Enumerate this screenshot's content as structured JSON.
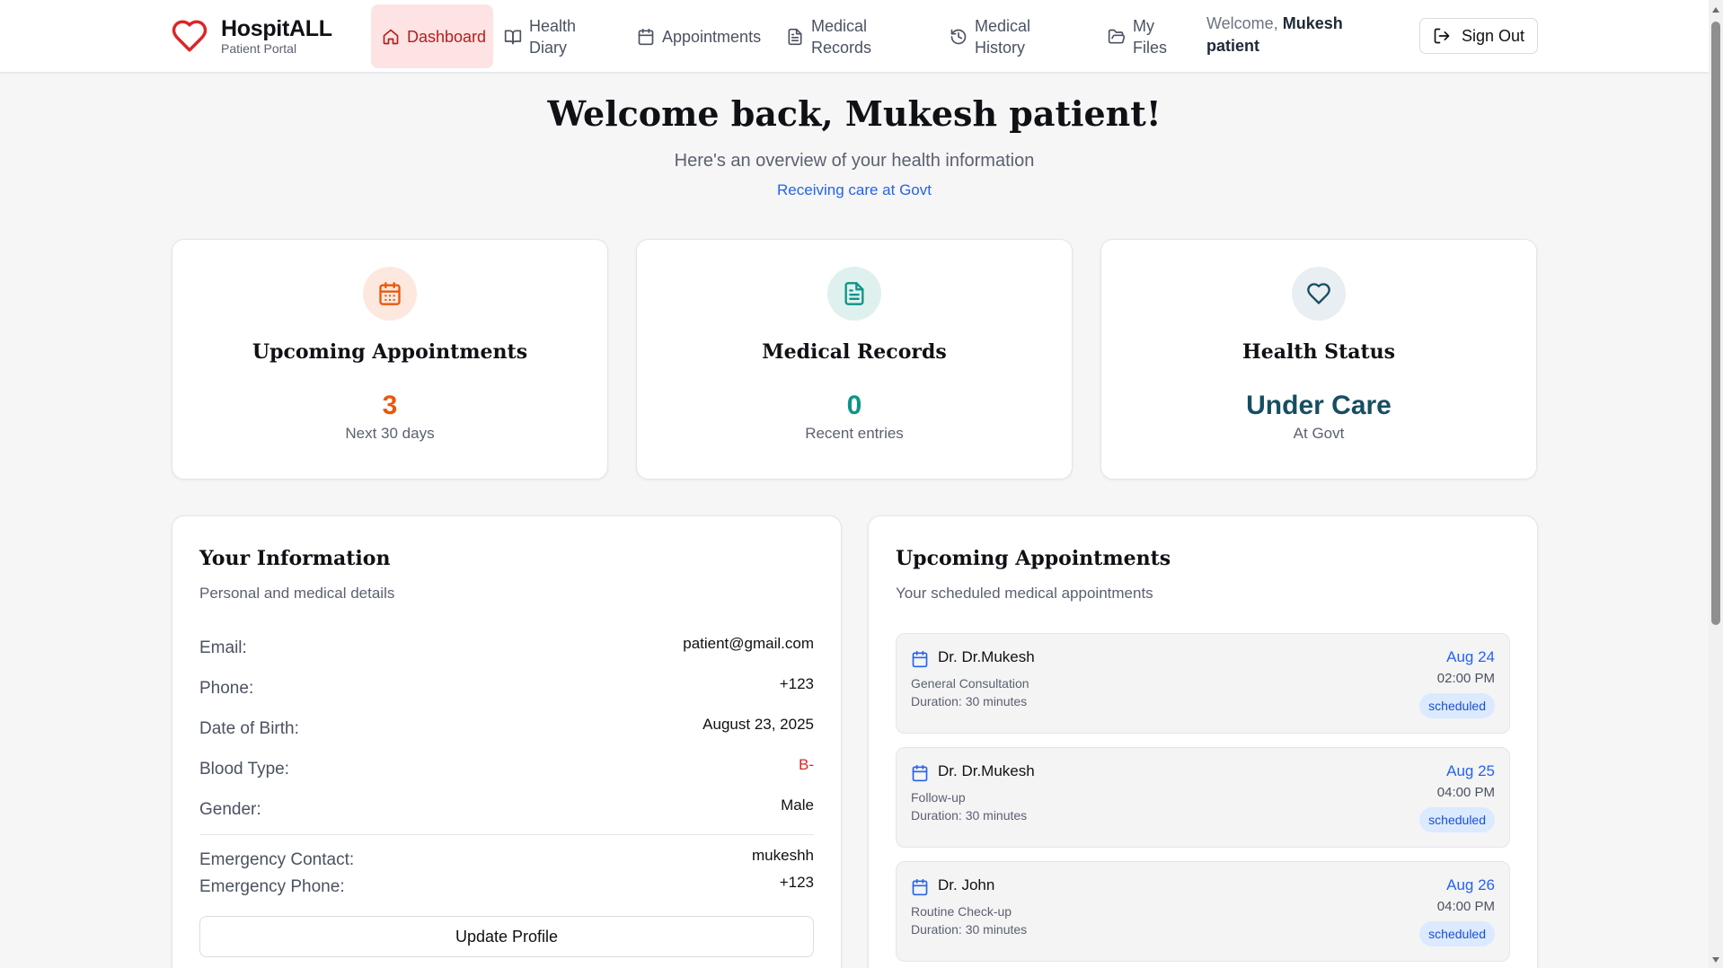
{
  "brand": {
    "name": "HospitALL",
    "subtitle": "Patient Portal"
  },
  "nav": {
    "items": [
      {
        "label": "Dashboard",
        "icon": "home-icon",
        "active": true
      },
      {
        "label": "Health Diary",
        "icon": "book-icon"
      },
      {
        "label": "Appointments",
        "icon": "calendar-icon"
      },
      {
        "label": "Medical Records",
        "icon": "file-text-icon"
      },
      {
        "label": "Medical History",
        "icon": "history-icon"
      },
      {
        "label": "My Files",
        "icon": "folder-open-icon"
      }
    ]
  },
  "user": {
    "welcome_prefix": "Welcome,",
    "name": "Mukesh patient"
  },
  "signout_label": "Sign Out",
  "hero": {
    "title": "Welcome back, Mukesh patient!",
    "subtitle": "Here's an overview of your health information",
    "care": "Receiving care at Govt"
  },
  "stats": [
    {
      "title": "Upcoming Appointments",
      "value": "3",
      "label": "Next 30 days",
      "icon": "calendar-icon",
      "color": "#ea580c",
      "bg": "#fde8e0"
    },
    {
      "title": "Medical Records",
      "value": "0",
      "label": "Recent entries",
      "icon": "file-text-icon",
      "color": "#0d9488",
      "bg": "#dff1ee"
    },
    {
      "title": "Health Status",
      "value": "Under Care",
      "label": "At Govt",
      "icon": "heart-icon",
      "color": "#164e63",
      "bg": "#e8eef1"
    }
  ],
  "info": {
    "title": "Your Information",
    "subtitle": "Personal and medical details",
    "rows": [
      {
        "label": "Email:",
        "value": "patient@gmail.com"
      },
      {
        "label": "Phone:",
        "value": "+123"
      },
      {
        "label": "Date of Birth:",
        "value": "August 23, 2025"
      },
      {
        "label": "Blood Type:",
        "value": "B-"
      },
      {
        "label": "Gender:",
        "value": "Male"
      }
    ],
    "emergency_contact_label": "Emergency Contact:",
    "emergency_contact_value": "mukeshh",
    "emergency_phone_label": "Emergency Phone:",
    "emergency_phone_value": "+123",
    "update_label": "Update Profile"
  },
  "appointments": {
    "title": "Upcoming Appointments",
    "subtitle": "Your scheduled medical appointments",
    "items": [
      {
        "doctor": "Dr. Dr.Mukesh",
        "type": "General Consultation",
        "duration": "Duration: 30 minutes",
        "date": "Aug 24",
        "time": "02:00 PM",
        "status": "scheduled"
      },
      {
        "doctor": "Dr. Dr.Mukesh",
        "type": "Follow-up",
        "duration": "Duration: 30 minutes",
        "date": "Aug 25",
        "time": "04:00 PM",
        "status": "scheduled"
      },
      {
        "doctor": "Dr. John",
        "type": "Routine Check-up",
        "duration": "Duration: 30 minutes",
        "date": "Aug 26",
        "time": "04:00 PM",
        "status": "scheduled"
      }
    ]
  },
  "colors": {
    "accent_red": "#b91c1c",
    "blood_type": "#dc2626",
    "link_blue": "#2563eb"
  }
}
